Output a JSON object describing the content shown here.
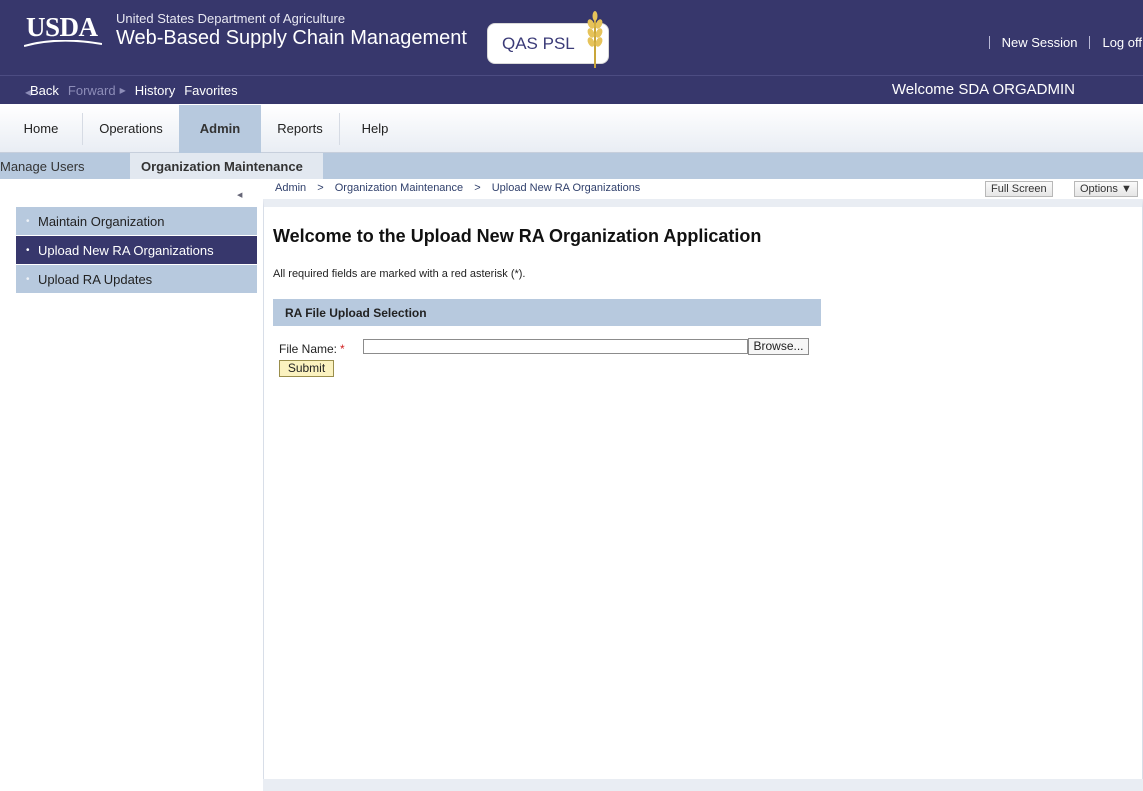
{
  "header": {
    "logo_text": "USDA",
    "department": "United States Department of Agriculture",
    "app_name": "Web-Based Supply Chain Management",
    "brand": "QAS PSL",
    "links": {
      "new_session": "New Session",
      "log_off": "Log off"
    }
  },
  "navbar": {
    "back": "Back",
    "forward": "Forward",
    "history": "History",
    "favorites": "Favorites",
    "welcome": "Welcome SDA ORGADMIN"
  },
  "tabs": [
    {
      "label": "Home"
    },
    {
      "label": "Operations"
    },
    {
      "label": "Admin"
    },
    {
      "label": "Reports"
    },
    {
      "label": "Help"
    }
  ],
  "subnav": {
    "manage_users": "Manage Users",
    "org_maintenance": "Organization Maintenance"
  },
  "sidebar": {
    "items": [
      {
        "label": "Maintain Organization"
      },
      {
        "label": "Upload New RA Organizations"
      },
      {
        "label": "Upload RA Updates"
      }
    ]
  },
  "breadcrumb": {
    "items": [
      "Admin",
      "Organization Maintenance",
      "Upload New RA Organizations"
    ],
    "separator": ">"
  },
  "toolbar": {
    "full_screen": "Full Screen",
    "options": "Options ▼"
  },
  "main": {
    "title": "Welcome to the Upload New RA Organization Application",
    "required_note": "All required fields are marked with a red asterisk (*).",
    "section_title": "RA File Upload Selection",
    "file_label": "File Name:",
    "asterisk": "*",
    "file_value": "",
    "browse_label": "Browse...",
    "submit_label": "Submit"
  },
  "colors": {
    "header_bg": "#37376c",
    "accent_blue": "#b7c9de",
    "required_red": "#d01f1f"
  }
}
